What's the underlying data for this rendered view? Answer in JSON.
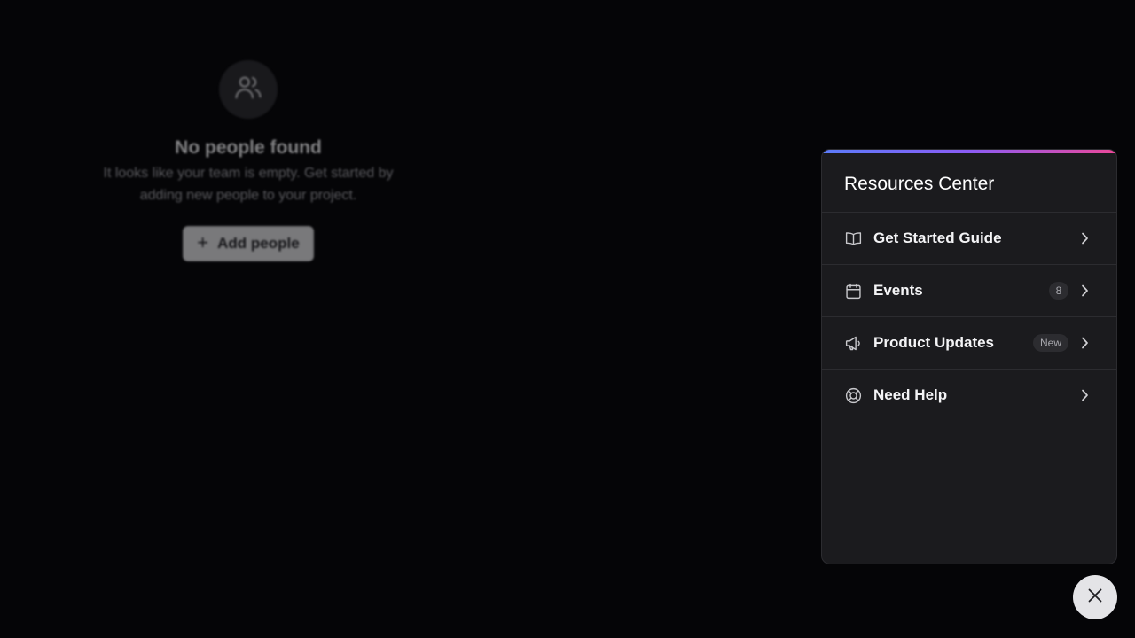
{
  "empty_state": {
    "icon": "users-icon",
    "title": "No people found",
    "description": "It looks like your team is empty. Get started by adding new people to your project.",
    "button_label": "Add people",
    "button_icon": "plus-icon"
  },
  "resources_center": {
    "title": "Resources Center",
    "accent_gradient": [
      "#5b7cfa",
      "#8b5cf6",
      "#ec4899"
    ],
    "items": [
      {
        "label": "Get Started Guide",
        "icon": "book-icon",
        "badge": ""
      },
      {
        "label": "Events",
        "icon": "calendar-icon",
        "badge": "8"
      },
      {
        "label": "Product Updates",
        "icon": "megaphone-icon",
        "badge": "New"
      },
      {
        "label": "Need Help",
        "icon": "lifebuoy-icon",
        "badge": ""
      }
    ]
  },
  "launcher": {
    "icon": "close-icon"
  }
}
